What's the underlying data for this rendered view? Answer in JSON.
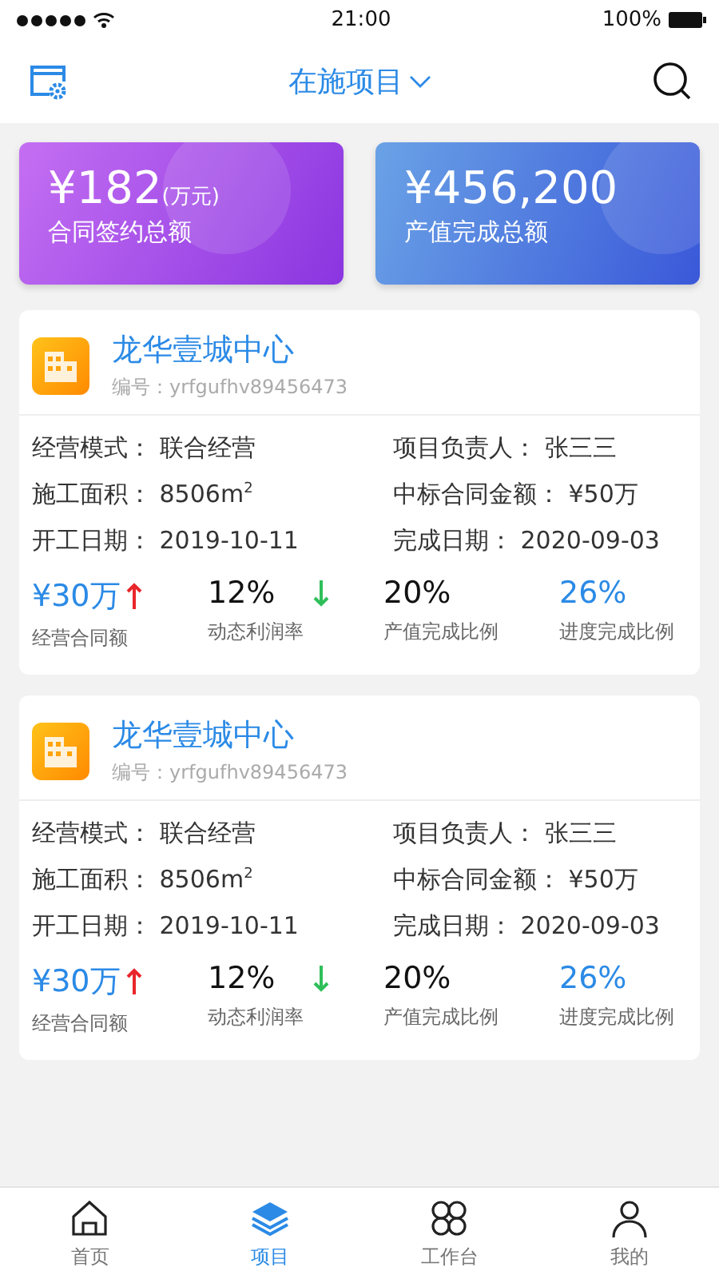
{
  "status_bar": {
    "time": "21:00",
    "battery": "100%"
  },
  "header": {
    "title": "在施项目"
  },
  "summary": [
    {
      "amount": "¥182",
      "unit": "(万元)",
      "label": "合同签约总额",
      "kind": "purple"
    },
    {
      "amount": "¥456,200",
      "label": "产值完成总额",
      "kind": "blue"
    }
  ],
  "projects": [
    {
      "name": "龙华壹城中心",
      "code": "编号：yrfgufhv89456473",
      "fields": [
        {
          "label": "经营模式：",
          "value": "联合经营"
        },
        {
          "label": "项目负责人：",
          "value": "张三三"
        },
        {
          "label": "施工面积：",
          "value": "8506m$^{2}$"
        },
        {
          "label": "中标合同金额：",
          "value": "¥50万"
        },
        {
          "label": "开工日期：",
          "value": "2019-10-11"
        },
        {
          "label": "完成日期：",
          "value": "2020-09-03"
        }
      ],
      "metrics": [
        {
          "value": "¥30万",
          "label": "经营合同额",
          "kind": "rising"
        },
        {
          "value": "12%",
          "label": "动态利润率",
          "kind": "falling"
        },
        {
          "value": "20%",
          "label": "产值完成比例",
          "kind": "plain"
        },
        {
          "value": "26%",
          "label": "进度完成比例",
          "kind": "highlight"
        }
      ]
    },
    {
      "name": "龙华壹城中心",
      "code": "编号：yrfgufhv89456473",
      "fields": [
        {
          "label": "经营模式：",
          "value": "联合经营"
        },
        {
          "label": "项目负责人：",
          "value": "张三三"
        },
        {
          "label": "施工面积：",
          "value": "8506m$^{2}$"
        },
        {
          "label": "中标合同金额：",
          "value": "¥50万"
        },
        {
          "label": "开工日期：",
          "value": "2019-10-11"
        },
        {
          "label": "完成日期：",
          "value": "2020-09-03"
        }
      ],
      "metrics": [
        {
          "value": "¥30万",
          "label": "经营合同额",
          "kind": "rising"
        },
        {
          "value": "12%",
          "label": "动态利润率",
          "kind": "falling"
        },
        {
          "value": "20%",
          "label": "产值完成比例",
          "kind": "plain"
        },
        {
          "value": "26%",
          "label": "进度完成比例",
          "kind": "highlight"
        }
      ]
    }
  ],
  "tabs": [
    {
      "label": "首页",
      "selected": false
    },
    {
      "label": "项目",
      "selected": true
    },
    {
      "label": "工作台",
      "selected": false
    },
    {
      "label": "我的",
      "selected": false
    }
  ]
}
